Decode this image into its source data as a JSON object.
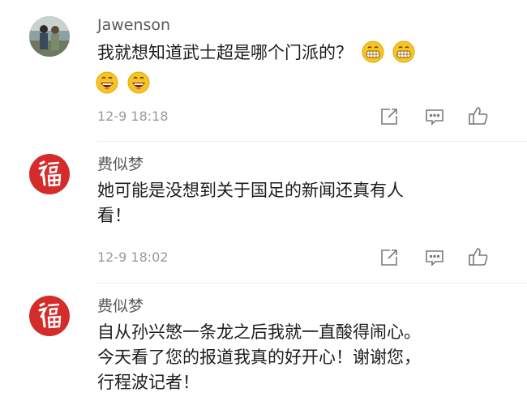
{
  "comments": [
    {
      "username": "Jawenson",
      "lines": [
        "我就想知道武士超是哪个门派的？"
      ],
      "time": "12-9  18:18"
    },
    {
      "username": "费似梦",
      "lines": [
        "她可能是没想到关于国足的新闻还真有人",
        "看！"
      ],
      "time": "12-9  18:02"
    },
    {
      "username": "费似梦",
      "lines": [
        "自从孙兴慜一条龙之后我就一直酸得闹心。",
        "今天看了您的报道我真的好开心！谢谢您，",
        "行程波记者！"
      ]
    }
  ],
  "icons": {
    "reply": "reply-icon",
    "comment": "comment-icon",
    "like": "thumbs-up-icon",
    "emoji_grin": "grinning-emoji-icon",
    "emoji_laugh": "laughing-emoji-icon",
    "avatar_fu": "fu-character-avatar"
  },
  "colors": {
    "username": "#5a5a5a",
    "meta": "#9a9a9a",
    "fu_avatar_bg": "#d42b2b",
    "emoji_yellow": "#f5c526"
  }
}
